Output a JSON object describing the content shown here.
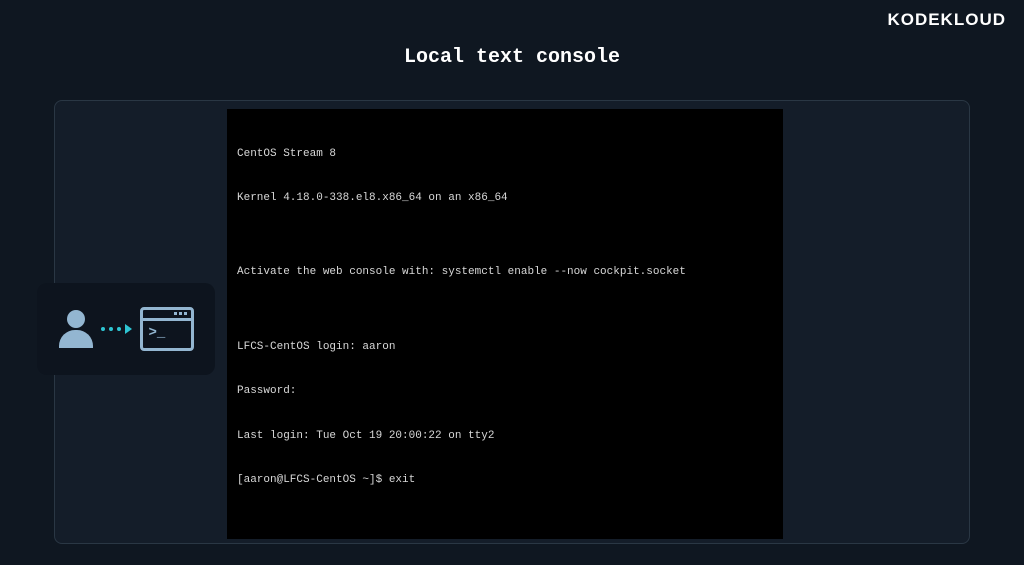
{
  "brand": "KODEKLOUD",
  "title": "Local text console",
  "terminal": {
    "lines": [
      "CentOS Stream 8",
      "Kernel 4.18.0-338.el8.x86_64 on an x86_64",
      "",
      "Activate the web console with: systemctl enable --now cockpit.socket",
      "",
      "LFCS-CentOS login: aaron",
      "Password:",
      "Last login: Tue Oct 19 20:00:22 on tty2",
      "[aaron@LFCS-CentOS ~]$ exit"
    ]
  },
  "illustration": {
    "prompt": ">_"
  }
}
